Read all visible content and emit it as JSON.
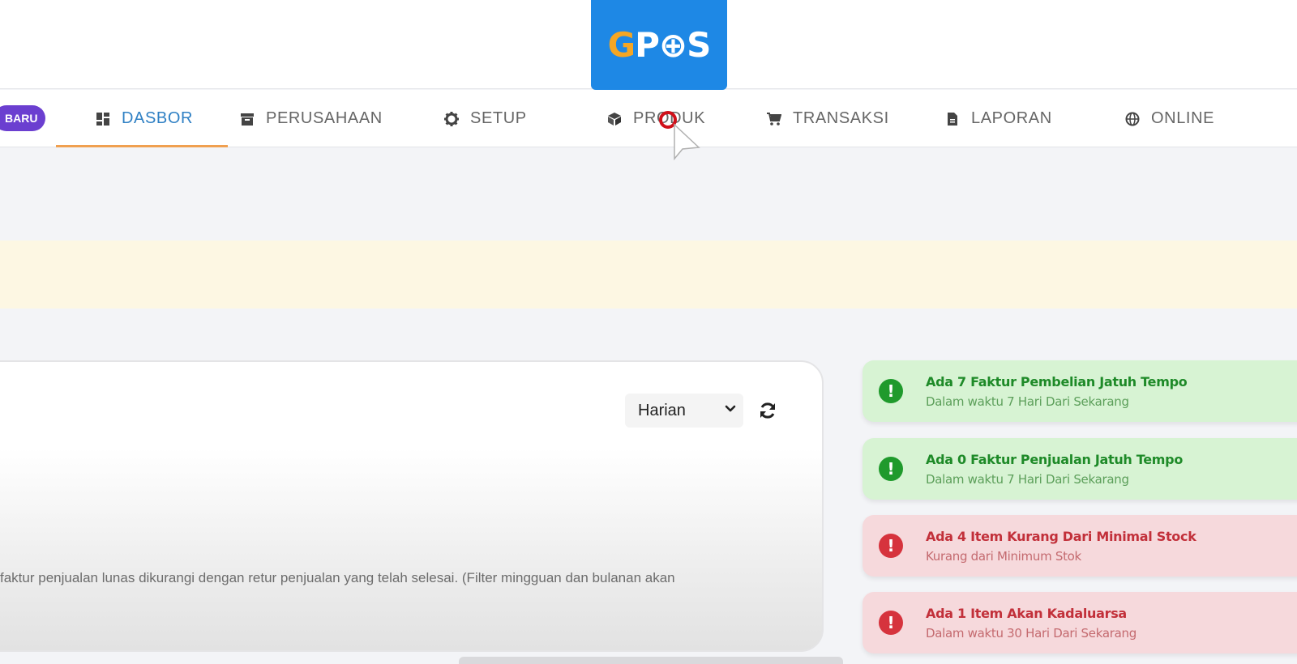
{
  "logo": {
    "g": "G",
    "rest": "P⊕S"
  },
  "nav": {
    "badge": "BARU",
    "items": [
      {
        "label": "DASBOR",
        "icon": "dashboard-icon"
      },
      {
        "label": "PERUSAHAAN",
        "icon": "archive-icon"
      },
      {
        "label": "SETUP",
        "icon": "gear-icon"
      },
      {
        "label": "PRODUK",
        "icon": "box-icon"
      },
      {
        "label": "TRANSAKSI",
        "icon": "cart-icon"
      },
      {
        "label": "LAPORAN",
        "icon": "document-icon"
      },
      {
        "label": "ONLINE",
        "icon": "globe-icon"
      }
    ],
    "active": "DASBOR"
  },
  "card": {
    "period_value": "Harian",
    "note": "faktur penjualan lunas dikurangi dengan retur penjualan yang telah selesai. (Filter mingguan dan bulanan akan"
  },
  "alerts": [
    {
      "title": "Ada 7 Faktur Pembelian Jatuh Tempo",
      "subtitle": "Dalam waktu 7 Hari Dari Sekarang",
      "status": "green"
    },
    {
      "title": "Ada 0 Faktur Penjualan Jatuh Tempo",
      "subtitle": "Dalam waktu 7 Hari Dari Sekarang",
      "status": "green"
    },
    {
      "title": "Ada 4 Item Kurang Dari Minimal Stock",
      "subtitle": "Kurang dari Minimum Stok",
      "status": "red"
    },
    {
      "title": "Ada 1 Item Akan Kadaluarsa",
      "subtitle": "Dalam waktu 30 Hari Dari Sekarang",
      "status": "red"
    }
  ],
  "colors": {
    "brand": "#1e88e5",
    "accent": "#f5a623",
    "active_nav": "#2f80c4",
    "badge": "#6b3fd0",
    "success": "#1f9a2c",
    "danger": "#d6333d"
  }
}
